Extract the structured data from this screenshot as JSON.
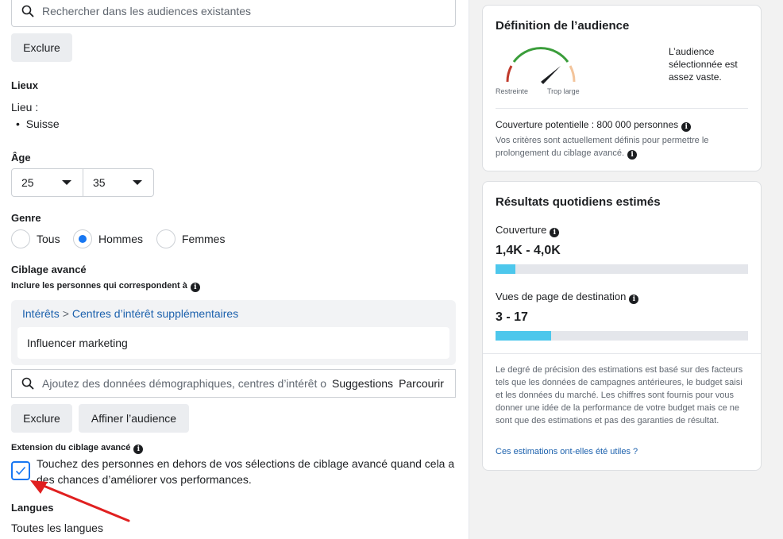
{
  "left": {
    "search_placeholder": "Rechercher dans les audiences existantes",
    "exclude_label": "Exclure",
    "locations": {
      "heading": "Lieux",
      "label": "Lieu :",
      "items": [
        "Suisse"
      ]
    },
    "age": {
      "heading": "Âge",
      "min": "25",
      "max": "35"
    },
    "gender": {
      "heading": "Genre",
      "options": [
        "Tous",
        "Hommes",
        "Femmes"
      ],
      "selected": "Hommes"
    },
    "advanced": {
      "heading": "Ciblage avancé",
      "include_label": "Inclure les personnes qui correspondent à",
      "breadcrumb": [
        "Intérêts",
        "Centres d’intérêt supplémentaires"
      ],
      "interest": "Influencer marketing",
      "search_placeholder": "Ajoutez des données démographiques, centres d’intérêt o",
      "suggestions_label": "Suggestions",
      "browse_label": "Parcourir",
      "exclude_label": "Exclure",
      "refine_label": "Affiner l’audience"
    },
    "expansion": {
      "heading": "Extension du ciblage avancé",
      "checkbox_label": "Touchez des personnes en dehors de vos sélections de ciblage avancé quand cela a des chances d’améliorer vos performances.",
      "checked": true
    },
    "languages": {
      "heading": "Langues",
      "value": "Toutes les langues"
    }
  },
  "right": {
    "definition": {
      "title": "Définition de l’audience",
      "gauge_left": "Restreinte",
      "gauge_right": "Trop large",
      "gauge_note": "L’audience sélectionnée est assez vaste.",
      "reach_text": "Couverture potentielle : 800 000 personnes",
      "criteria_note": "Vos critères sont actuellement définis pour permettre le prolongement du ciblage avancé."
    },
    "estimates": {
      "title": "Résultats quotidiens estimés",
      "reach_label": "Couverture",
      "reach_value": "1,4K - 4,0K",
      "reach_fraction": 0.08,
      "views_label": "Vues de page de destination",
      "views_value": "3 - 17",
      "views_fraction": 0.22,
      "disclaimer": "Le degré de précision des estimations est basé sur des facteurs tels que les données de campagnes antérieures, le budget saisi et les données du marché. Les chiffres sont fournis pour vous donner une idée de la performance de votre budget mais ce ne sont que des estimations et pas des garanties de résultat.",
      "feedback_link": "Ces estimations ont-elles été utiles ?"
    }
  },
  "colors": {
    "accent": "#1877f2",
    "link": "#1c61ad",
    "bar_fill": "#4dc7ec",
    "gauge_green": "#3a9d3a",
    "gauge_red": "#c0392b",
    "gauge_peach": "#f3c49b",
    "arrow_red": "#e02020"
  }
}
